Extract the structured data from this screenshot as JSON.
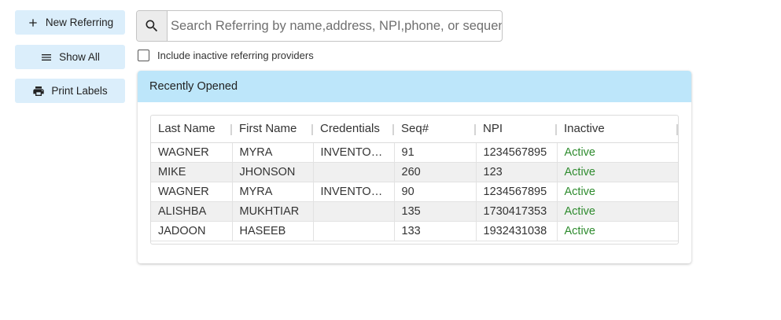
{
  "actions": {
    "new_referring": "New Referring",
    "show_all": "Show All",
    "print_labels": "Print Labels"
  },
  "search": {
    "placeholder": "Search Referring by name,address, NPI,phone, or sequence#",
    "value": ""
  },
  "filter": {
    "include_inactive_label": "Include inactive referring providers",
    "include_inactive_checked": false
  },
  "recent": {
    "title": "Recently Opened",
    "columns": [
      "Last Name",
      "First Name",
      "Credentials",
      "Seq#",
      "NPI",
      "Inactive"
    ],
    "rows": [
      [
        "WAGNER",
        "MYRA",
        "INVENTO…",
        "91",
        "1234567895",
        "Active"
      ],
      [
        "MIKE",
        "JHONSON",
        "",
        "260",
        "123",
        "Active"
      ],
      [
        "WAGNER",
        "MYRA",
        "INVENTO…",
        "90",
        "1234567895",
        "Active"
      ],
      [
        "ALISHBA",
        "MUKHTIAR",
        "",
        "135",
        "1730417353",
        "Active"
      ],
      [
        "JADOON",
        "HASEEB",
        "",
        "133",
        "1932431038",
        "Active"
      ]
    ]
  },
  "colors": {
    "button_bg": "#dbeefb",
    "header_bg": "#bde6fa",
    "active_text": "#2e8b2e"
  },
  "icons": {
    "new": "plus-icon",
    "show_all": "menu-icon",
    "print": "printer-icon",
    "search": "search-icon"
  }
}
